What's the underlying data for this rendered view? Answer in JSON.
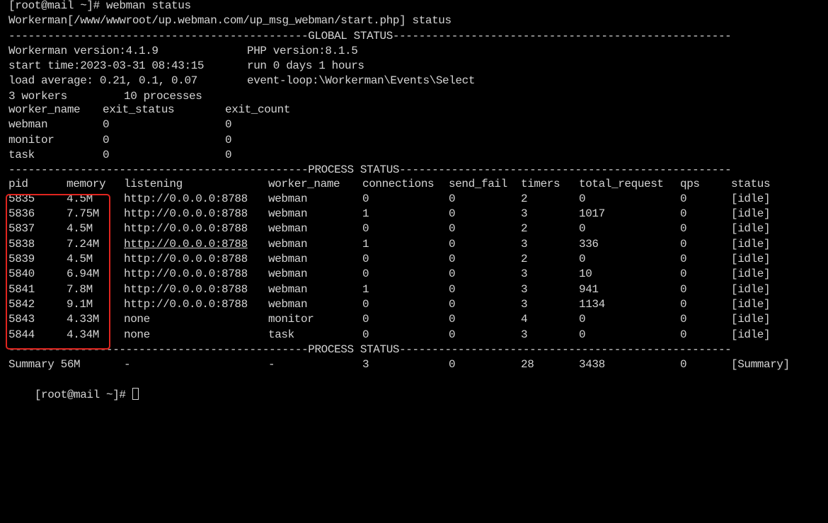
{
  "prompt_cmd": "[root@mail ~]# webman status",
  "workerman_line": "Workerman[/www/wwwroot/up.webman.com/up_msg_webman/start.php] status",
  "global_sep": "----------------------------------------------GLOBAL STATUS----------------------------------------------------",
  "global": {
    "wm_version": "Workerman version:4.1.9",
    "php_version": "PHP version:8.1.5",
    "start_time": "start time:2023-03-31 08:43:15",
    "run_time": "run 0 days 1 hours",
    "load_avg": "load average: 0.21, 0.1, 0.07",
    "event_loop": "event-loop:\\Workerman\\Events\\Select",
    "workers": "3 workers",
    "processes": "10 processes"
  },
  "worker_table": {
    "headers": [
      "worker_name",
      "exit_status",
      "exit_count"
    ],
    "rows": [
      [
        "webman",
        "0",
        "0"
      ],
      [
        "monitor",
        "0",
        "0"
      ],
      [
        "task",
        "0",
        "0"
      ]
    ]
  },
  "process_sep": "----------------------------------------------PROCESS STATUS---------------------------------------------------",
  "process_table": {
    "headers": [
      "pid",
      "memory",
      "listening",
      "worker_name",
      "connections",
      "send_fail",
      "timers",
      "total_request",
      "qps",
      "status"
    ],
    "rows": [
      [
        "5835",
        "4.5M",
        "http://0.0.0.0:8788",
        "webman",
        "0",
        "0",
        "2",
        "0",
        "0",
        "[idle]"
      ],
      [
        "5836",
        "7.75M",
        "http://0.0.0.0:8788",
        "webman",
        "1",
        "0",
        "3",
        "1017",
        "0",
        "[idle]"
      ],
      [
        "5837",
        "4.5M",
        "http://0.0.0.0:8788",
        "webman",
        "0",
        "0",
        "2",
        "0",
        "0",
        "[idle]"
      ],
      [
        "5838",
        "7.24M",
        "http://0.0.0.0:8788",
        "webman",
        "1",
        "0",
        "3",
        "336",
        "0",
        "[idle]"
      ],
      [
        "5839",
        "4.5M",
        "http://0.0.0.0:8788",
        "webman",
        "0",
        "0",
        "2",
        "0",
        "0",
        "[idle]"
      ],
      [
        "5840",
        "6.94M",
        "http://0.0.0.0:8788",
        "webman",
        "0",
        "0",
        "3",
        "10",
        "0",
        "[idle]"
      ],
      [
        "5841",
        "7.8M",
        "http://0.0.0.0:8788",
        "webman",
        "1",
        "0",
        "3",
        "941",
        "0",
        "[idle]"
      ],
      [
        "5842",
        "9.1M",
        "http://0.0.0.0:8788",
        "webman",
        "0",
        "0",
        "3",
        "1134",
        "0",
        "[idle]"
      ],
      [
        "5843",
        "4.33M",
        "none",
        "monitor",
        "0",
        "0",
        "4",
        "0",
        "0",
        "[idle]"
      ],
      [
        "5844",
        "4.34M",
        "none",
        "task",
        "0",
        "0",
        "3",
        "0",
        "0",
        "[idle]"
      ]
    ],
    "underlined_row_index": 3
  },
  "summary": {
    "label": "Summary 56M",
    "listening": "-",
    "worker_name": "-",
    "connections": "3",
    "send_fail": "0",
    "timers": "28",
    "total_request": "3438",
    "qps": "0",
    "status": "[Summary]"
  },
  "prompt_end": "[root@mail ~]# ",
  "colors": {
    "background": "#000000",
    "text": "#d4d4d4",
    "highlight_box": "#e0251f"
  }
}
